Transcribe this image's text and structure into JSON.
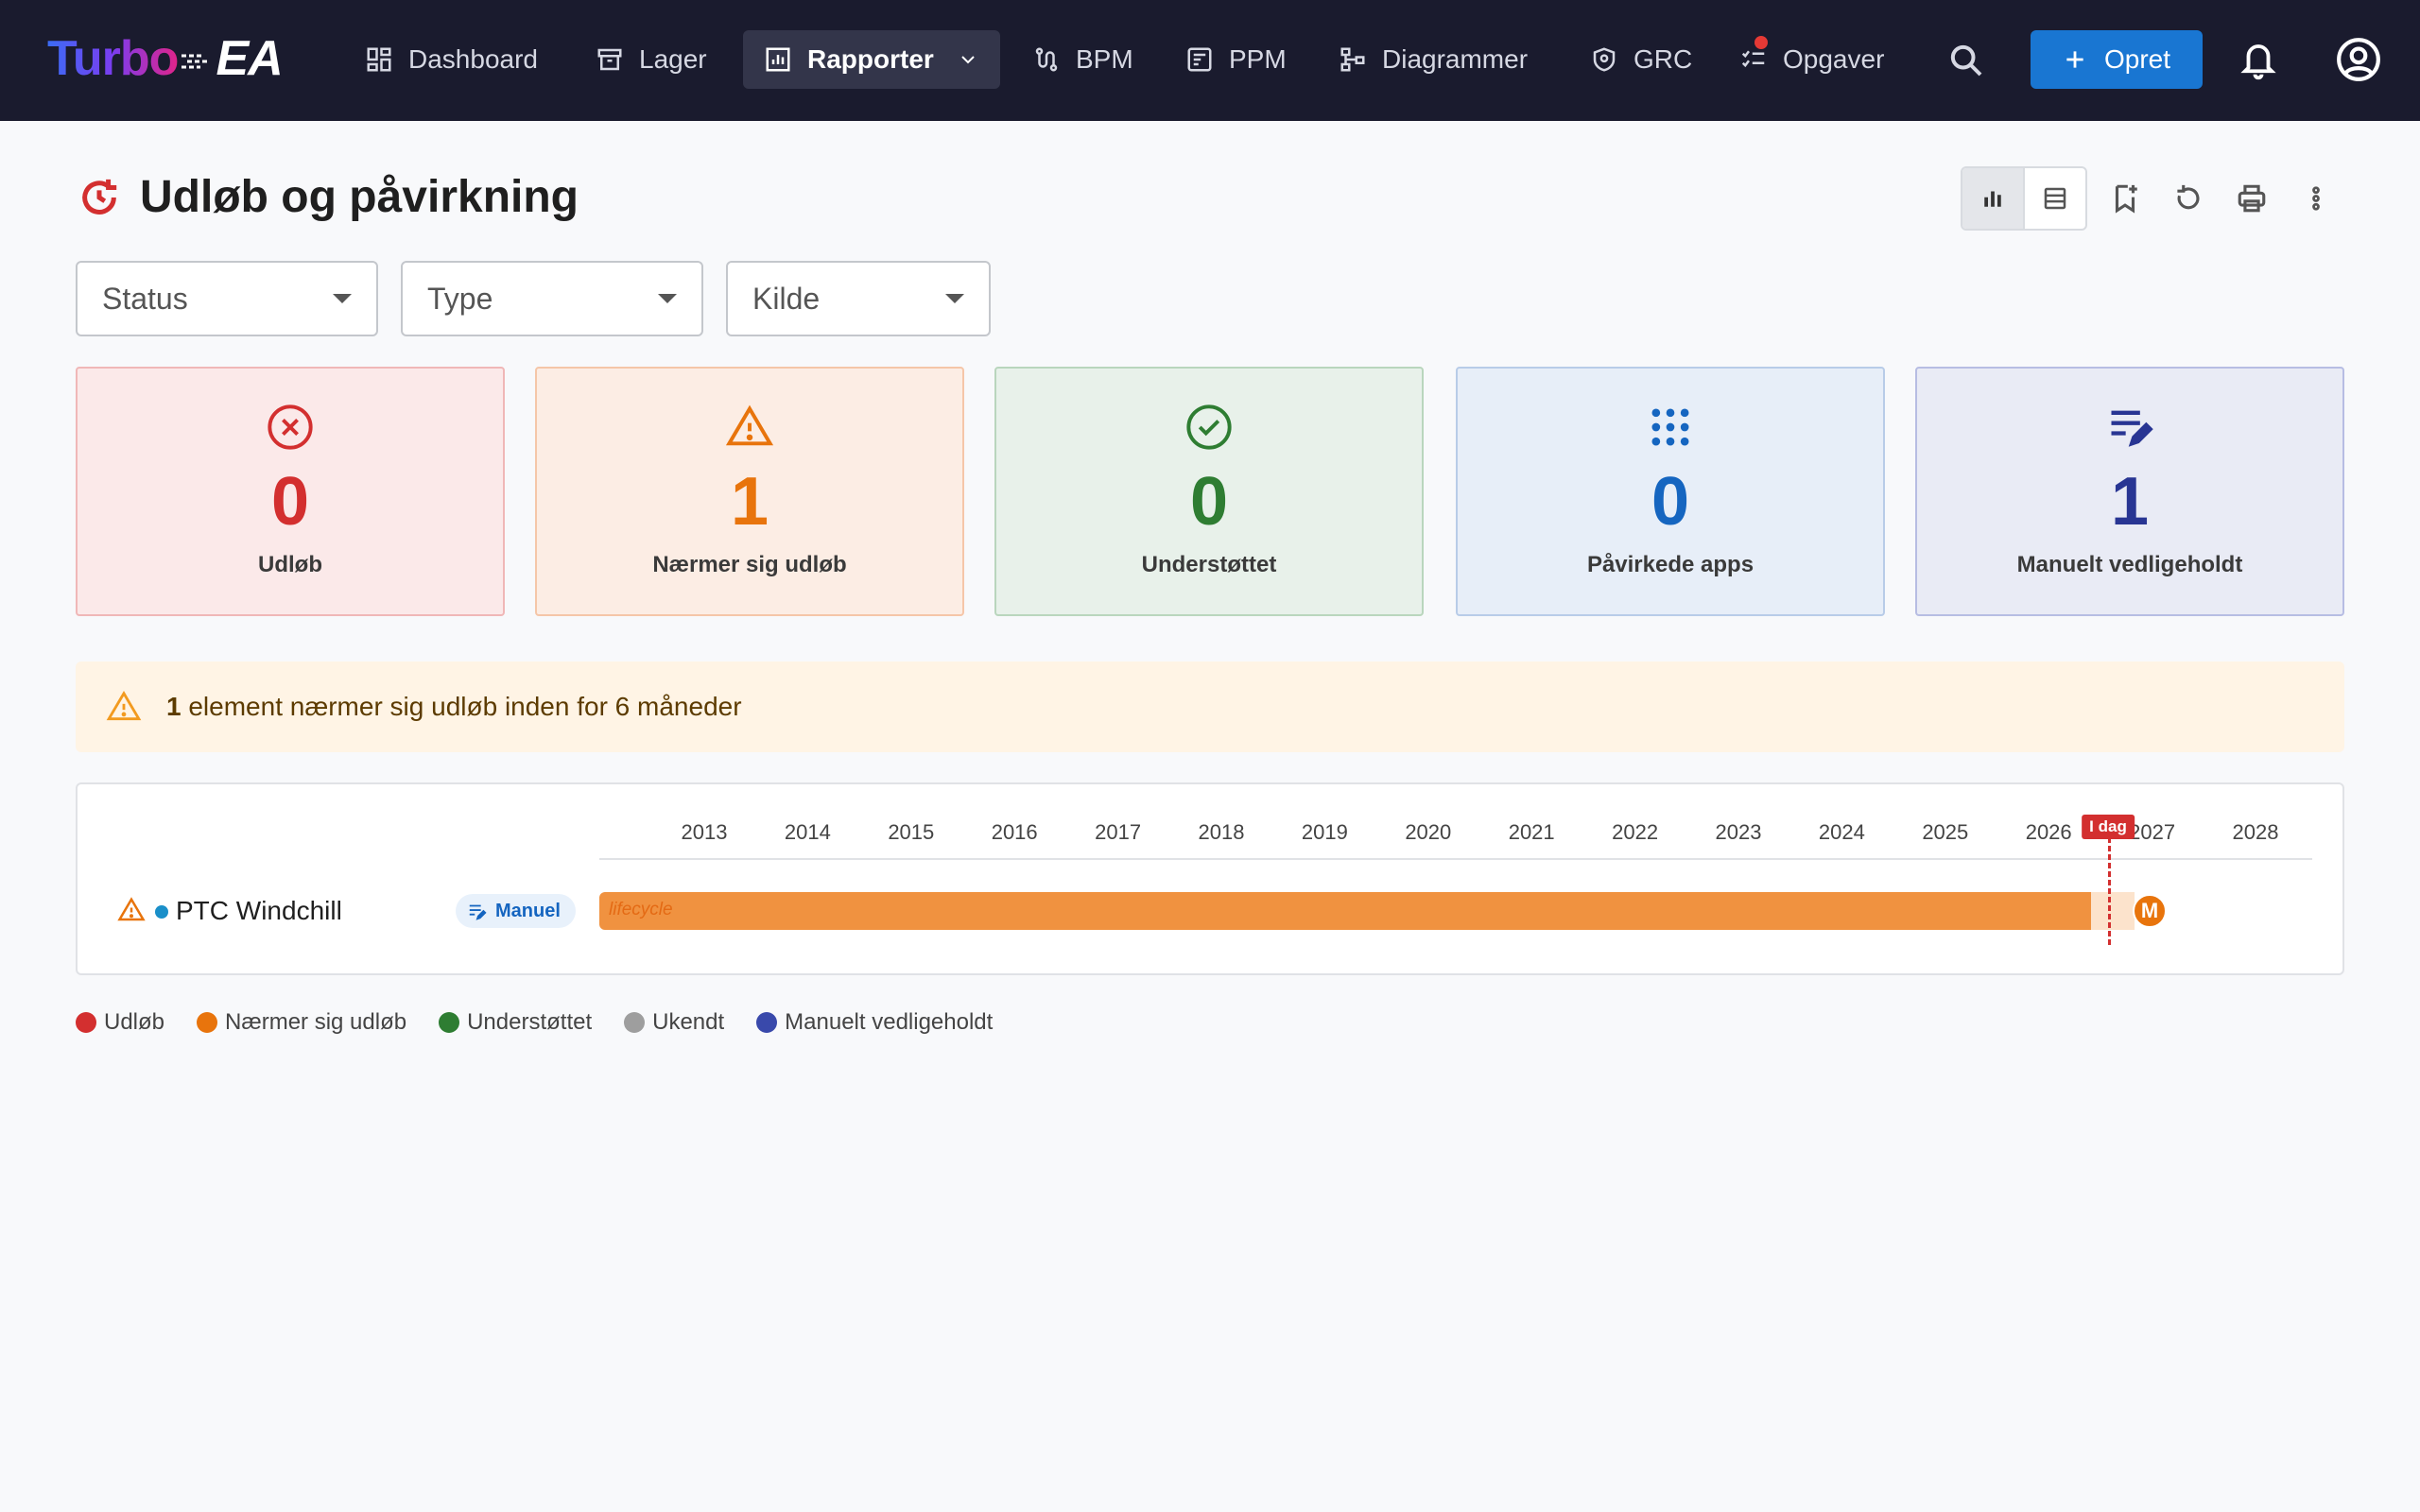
{
  "app": {
    "logo_main": "Turbo",
    "logo_suffix": "EA"
  },
  "nav": {
    "items": [
      {
        "label": "Dashboard",
        "icon": "dashboard-icon"
      },
      {
        "label": "Lager",
        "icon": "archive-icon"
      },
      {
        "label": "Rapporter",
        "icon": "report-icon",
        "active": true,
        "has_dropdown": true
      },
      {
        "label": "BPM",
        "icon": "process-icon"
      },
      {
        "label": "PPM",
        "icon": "portfolio-icon"
      },
      {
        "label": "Diagrammer",
        "icon": "diagram-icon"
      },
      {
        "label": "GRC",
        "icon": "shield-icon"
      },
      {
        "label": "Opgaver",
        "icon": "tasks-icon",
        "has_notification_dot": true
      }
    ],
    "create_label": "Opret"
  },
  "page": {
    "title": "Udløb og påvirkning"
  },
  "filters": [
    {
      "label": "Status"
    },
    {
      "label": "Type"
    },
    {
      "label": "Kilde"
    }
  ],
  "kpis": [
    {
      "value": "0",
      "label": "Udløb",
      "icon": "cancel-circle-icon",
      "color": "#d32f2f"
    },
    {
      "value": "1",
      "label": "Nærmer sig udløb",
      "icon": "warning-triangle-icon",
      "color": "#e8740c"
    },
    {
      "value": "0",
      "label": "Understøttet",
      "icon": "check-circle-icon",
      "color": "#2e7d32"
    },
    {
      "value": "0",
      "label": "Påvirkede apps",
      "icon": "apps-grid-icon",
      "color": "#1565c0"
    },
    {
      "value": "1",
      "label": "Manuelt vedligeholdt",
      "icon": "edit-list-icon",
      "color": "#283593"
    }
  ],
  "alert": {
    "count": "1",
    "text": "element nærmer sig udløb inden for 6 måneder"
  },
  "timeline": {
    "years": [
      "2013",
      "2014",
      "2015",
      "2016",
      "2017",
      "2018",
      "2019",
      "2020",
      "2021",
      "2022",
      "2023",
      "2024",
      "2025",
      "2026",
      "2027",
      "2028"
    ],
    "today_label": "I dag",
    "rows": [
      {
        "name": "PTC Windchill",
        "chip": "Manuel",
        "bar_label": "lifecycle",
        "marker": "M",
        "status": "Nærmer sig udløb"
      }
    ]
  },
  "legend": [
    {
      "label": "Udløb",
      "color": "#d32f2f"
    },
    {
      "label": "Nærmer sig udløb",
      "color": "#e8740c"
    },
    {
      "label": "Understøttet",
      "color": "#2e7d32"
    },
    {
      "label": "Ukendt",
      "color": "#9e9e9e"
    },
    {
      "label": "Manuelt vedligeholdt",
      "color": "#3949ab"
    }
  ]
}
